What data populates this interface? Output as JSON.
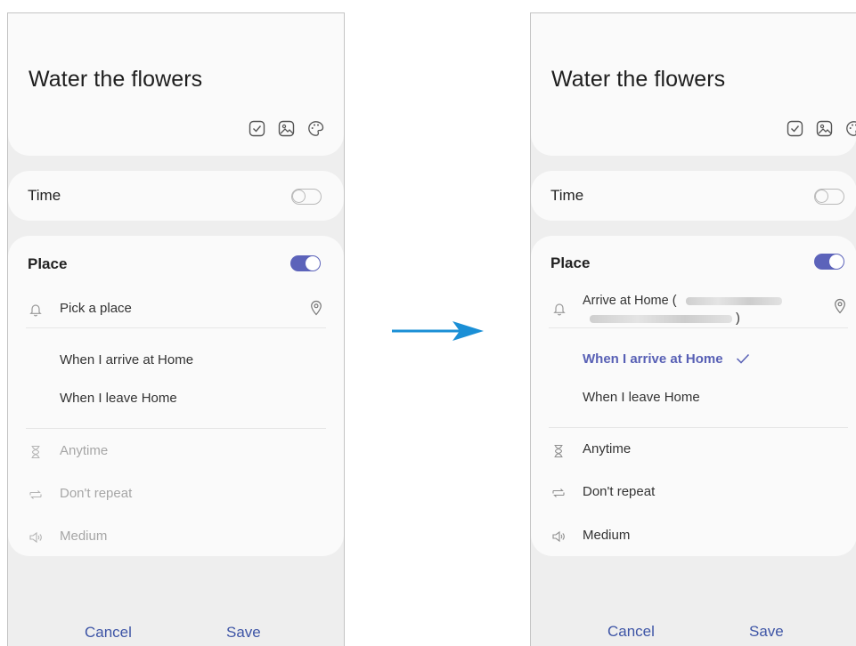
{
  "left": {
    "title": "Water the flowers",
    "time_label": "Time",
    "place_label": "Place",
    "location_row": "Pick a place",
    "options": [
      "When I arrive at Home",
      "When I leave Home"
    ],
    "details": [
      "Anytime",
      "Don't repeat",
      "Medium"
    ],
    "cancel": "Cancel",
    "save": "Save"
  },
  "right": {
    "title": "Water the flowers",
    "time_label": "Time",
    "place_label": "Place",
    "location_row_prefix": "Arrive at Home (",
    "location_row_suffix": ")",
    "options": [
      "When I arrive at Home",
      "When I leave Home"
    ],
    "details": [
      "Anytime",
      "Don't repeat",
      "Medium"
    ],
    "cancel": "Cancel",
    "save": "Save"
  },
  "colors": {
    "accent": "#5c63ba",
    "footer_button": "#3e55a6",
    "arrow": "#1a8fd6",
    "muted_text": "#a6a6a6"
  },
  "icons": [
    "checkbox-icon",
    "image-icon",
    "palette-icon",
    "bell-icon",
    "location-pin-icon",
    "hourglass-icon",
    "repeat-icon",
    "volume-icon",
    "check-icon",
    "right-arrow-icon"
  ]
}
